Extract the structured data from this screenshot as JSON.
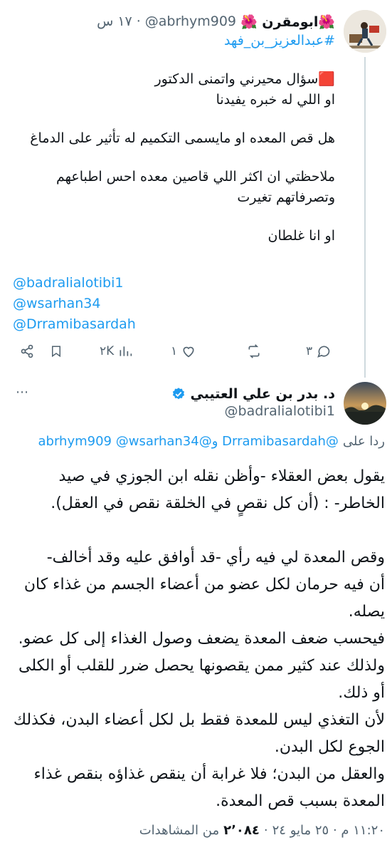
{
  "tweet1": {
    "display_name": "🌺ابومقرن 🌺",
    "handle": "@abrhym909",
    "separator": "·",
    "time": "١٧ س",
    "hashtag": "#عبدالعزيز_بن_فهد",
    "red_marker": "🟥",
    "line1": "سؤال محيرني واتمنى الدكتور",
    "line2": "او اللي له خبره يفيدنا",
    "line3": "هل قص المعده او مايسمى التكميم له تأثير على الدماغ",
    "line4": "ملاحظتي ان اكثر اللي قاصين معده احس اطباعهم",
    "line5": "وتصرفاتهم تغيرت",
    "line6": "او انا غلطان",
    "mentions": [
      "@badralialotibi1",
      "@wsarhan34",
      "@Drramibasardah"
    ],
    "actions": {
      "replies": "٣",
      "retweets": "",
      "likes": "١",
      "views": "٢K"
    }
  },
  "tweet2": {
    "display_name": "د. بدر بن علي العتيبي",
    "verified": true,
    "handle": "@badralialotibi1",
    "reply_prefix": "ردا على",
    "reply_mentions": "@Drramibasardah و@abrhym909 @wsarhan34",
    "body_lines": [
      "يقول بعض العقلاء -وأظن نقله ابن الجوزي في صيد",
      "الخاطر- : (أن كل نقصٍ في الخلقة نقص في العقل).",
      "",
      "وقص المعدة لي فيه رأي -قد أوافق عليه وقد أخالف-",
      "أن فيه حرمان لكل عضو من أعضاء الجسم من غذاء كان",
      "يصله.",
      "فيحسب ضعف المعدة يضعف وصول الغذاء إلى كل عضو.",
      "ولذلك عند كثير ممن يقصونها يحصل ضرر للقلب أو الكلى",
      "أو ذلك.",
      "لأن التغذي ليس للمعدة فقط بل لكل أعضاء البدن، فكذلك",
      "الجوع لكل البدن.",
      "والعقل من البدن؛ فلا غرابة أن ينقص غذاؤه بنقص غذاء",
      "المعدة بسبب قص المعدة."
    ],
    "footer_time": "١١:٢٠ م · ٢٥ مايو ٢٤",
    "footer_views_count": "٢٬٠٨٤",
    "footer_views_label": "من المشاهدات"
  },
  "colors": {
    "link": "#1d9bf0",
    "muted": "#536471",
    "text": "#0f1419",
    "verified": "#1d9bf0",
    "red_marker": "#e0242b"
  }
}
